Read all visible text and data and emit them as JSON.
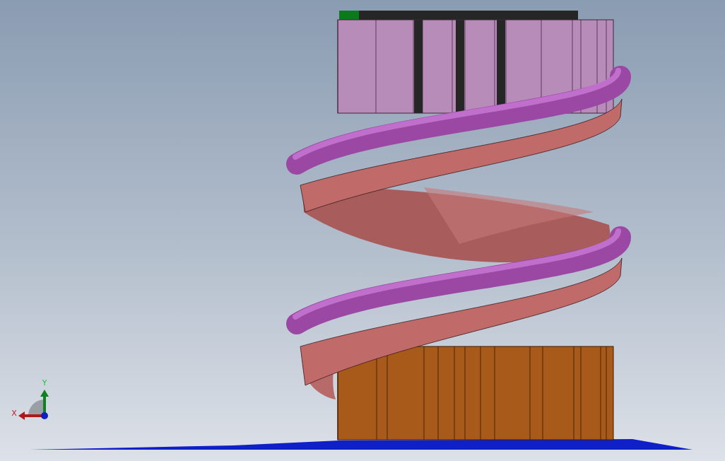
{
  "viewport": {
    "triad": {
      "axes": [
        {
          "kind": "x",
          "label": "X"
        },
        {
          "kind": "y",
          "label": "Y"
        }
      ]
    }
  }
}
